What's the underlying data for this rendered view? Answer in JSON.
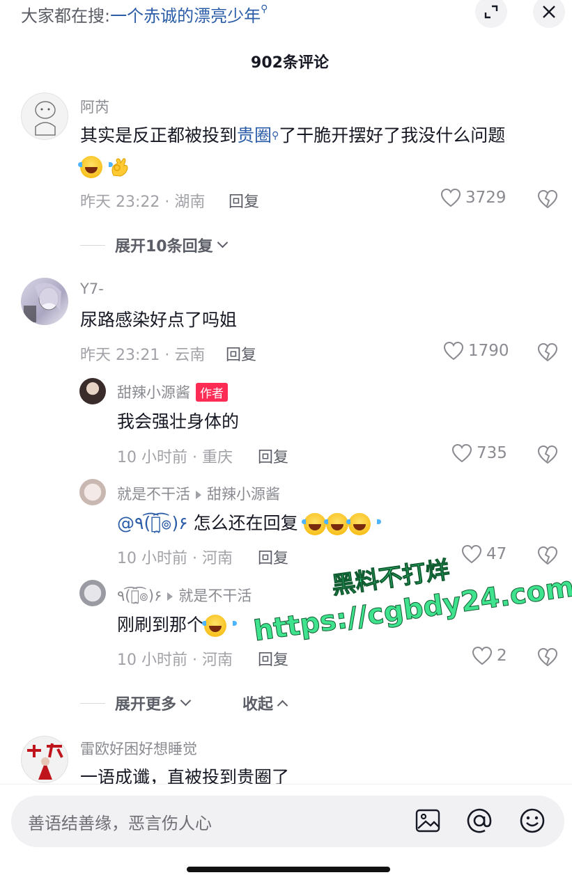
{
  "search": {
    "prefix": "大家都在搜:",
    "keyword": "一个赤诚的漂亮少年"
  },
  "header": {
    "comment_count": "902条评论"
  },
  "comments": [
    {
      "username": "阿芮",
      "text_before": "其实是反正都被投到",
      "link": "贵圈",
      "text_after": "了干脆开摆好了我没什么问题",
      "meta": "昨天 23:22 · 湖南",
      "reply": "回复",
      "likes": "3729",
      "expand": "展开10条回复"
    },
    {
      "username": "Y7-",
      "text": "尿路感染好点了吗姐",
      "meta": "昨天 23:21 · 云南",
      "reply": "回复",
      "likes": "1790"
    }
  ],
  "replies": [
    {
      "username": "甜辣小源酱",
      "badge": "作者",
      "text": "我会强壮身体的",
      "meta": "10 小时前 · 重庆",
      "reply": "回复",
      "likes": "735"
    },
    {
      "username": "就是不干活",
      "reply_to": "甜辣小源酱",
      "mention": "@٩(͡๏̯͡๏)۶",
      "text": " 怎么还在回复",
      "meta": "10 小时前 · 河南",
      "reply": "回复",
      "likes": "47"
    },
    {
      "username": "٩(͡๏̯͡๏)۶",
      "reply_to": "就是不干活",
      "text": "刚刷到那个",
      "meta": "10 小时前 · 河南",
      "reply": "回复",
      "likes": "2"
    }
  ],
  "thread_actions": {
    "expand_more": "展开更多",
    "collapse": "收起"
  },
  "next_comment": {
    "username": "雷欧好困好想睡觉",
    "text": "一语成谶，直被投到贵圈了"
  },
  "watermark": {
    "line1": "黑料不打烊",
    "line2": "https://cgbdy24.com"
  },
  "input": {
    "placeholder": "善语结善缘，恶言伤人心"
  },
  "icons": [
    "expand-icon",
    "close-icon",
    "search-icon",
    "heart-icon",
    "dislike-icon",
    "image-icon",
    "at-icon",
    "emoji-icon"
  ],
  "colors": {
    "link": "#2a5ca8",
    "badge": "#fe2c55",
    "watermark": "#3fe38e"
  }
}
